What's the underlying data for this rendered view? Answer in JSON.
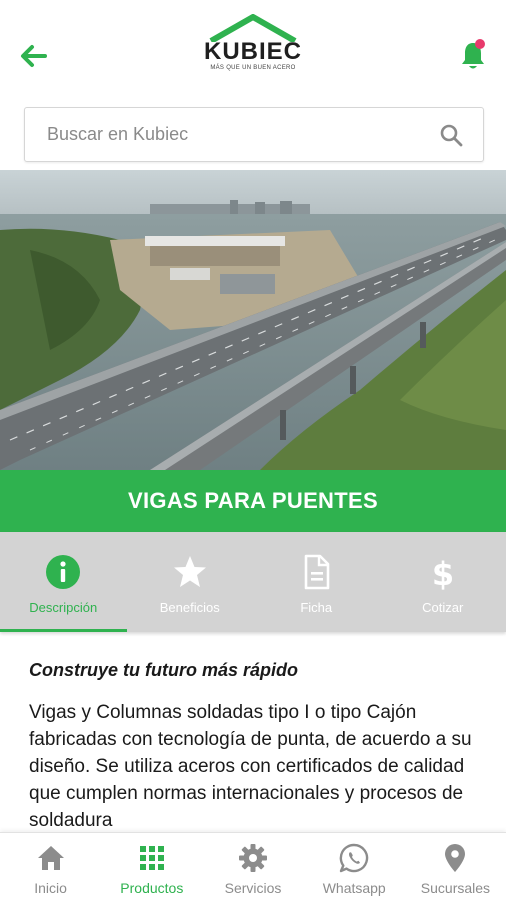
{
  "header": {
    "brand": "KUBIEC",
    "tagline": "MÁS QUE UN BUEN ACERO",
    "accent_color": "#2fb24f",
    "back_icon": "arrow-left-icon",
    "notification_icon": "bell-icon"
  },
  "search": {
    "placeholder": "Buscar en Kubiec",
    "value": "",
    "icon": "search-icon"
  },
  "product": {
    "title": "VIGAS PARA PUENTES"
  },
  "tabs": [
    {
      "label": "Descripción",
      "icon": "info-icon",
      "active": true
    },
    {
      "label": "Beneficios",
      "icon": "star-icon",
      "active": false
    },
    {
      "label": "Ficha",
      "icon": "document-icon",
      "active": false
    },
    {
      "label": "Cotizar",
      "icon": "dollar-icon",
      "active": false
    }
  ],
  "content": {
    "heading": "Construye tu futuro más rápido",
    "body": "Vigas y Columnas soldadas tipo I o tipo Cajón fabricadas con tecnología de punta, de acuerdo a su diseño. Se utiliza aceros con certificados de calidad que cumplen normas internacionales y procesos de soldadura"
  },
  "bottom_nav": [
    {
      "label": "Inicio",
      "icon": "home-icon",
      "active": false
    },
    {
      "label": "Productos",
      "icon": "grid-icon",
      "active": true
    },
    {
      "label": "Servicios",
      "icon": "gear-icon",
      "active": false
    },
    {
      "label": "Whatsapp",
      "icon": "whatsapp-icon",
      "active": false
    },
    {
      "label": "Sucursales",
      "icon": "location-pin-icon",
      "active": false
    }
  ]
}
